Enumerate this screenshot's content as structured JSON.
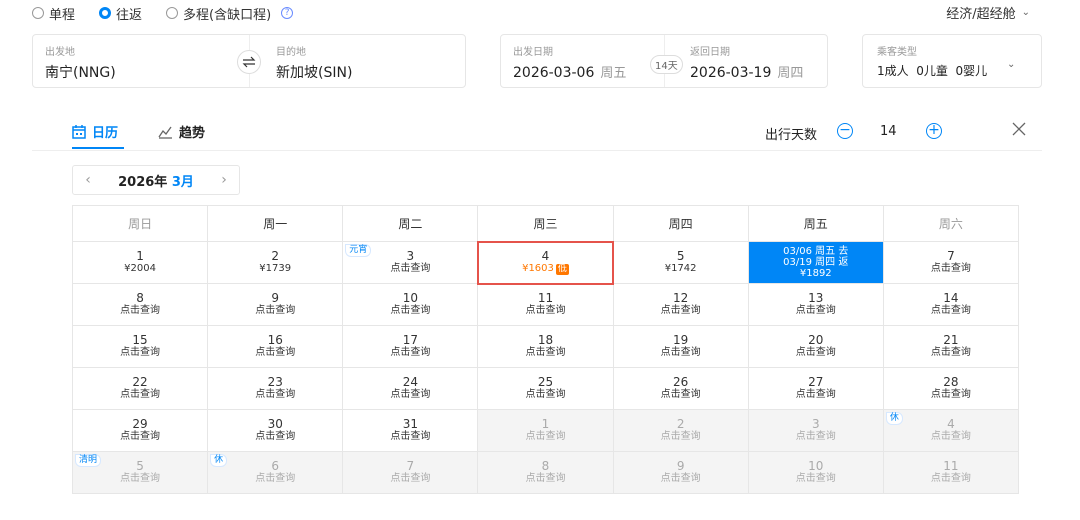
{
  "trip_types": [
    {
      "label": "单程",
      "checked": false
    },
    {
      "label": "往返",
      "checked": true
    },
    {
      "label": "多程(含缺口程)",
      "checked": false
    }
  ],
  "help_glyph": "?",
  "cabin": {
    "label": "经济/超经舱"
  },
  "origin": {
    "label": "出发地",
    "value": "南宁(NNG)"
  },
  "destination": {
    "label": "目的地",
    "value": "新加坡(SIN)"
  },
  "depart": {
    "label": "出发日期",
    "date": "2026-03-06",
    "weekday": "周五"
  },
  "days_pill": "14天",
  "return": {
    "label": "返回日期",
    "date": "2026-03-19",
    "weekday": "周四"
  },
  "passengers": {
    "label": "乘客类型",
    "value": "1成人  0儿童  0婴儿"
  },
  "tabs": {
    "calendar": "日历",
    "trend": "趋势"
  },
  "trip_days": {
    "label": "出行天数",
    "value": "14"
  },
  "month_nav": {
    "year": "2026年",
    "month": "3月"
  },
  "weekdays": [
    "周日",
    "周一",
    "周二",
    "周三",
    "周四",
    "周五",
    "周六"
  ],
  "calendar": [
    [
      {
        "d": "1",
        "p": "¥2004"
      },
      {
        "d": "2",
        "p": "¥1739"
      },
      {
        "d": "3",
        "p": "点击查询",
        "tag": "元宵"
      },
      {
        "d": "4",
        "p": "¥1603",
        "low": "低",
        "hl": true
      },
      {
        "d": "5",
        "p": "¥1742"
      },
      {
        "sel": true,
        "l1": "03/06 周五 去",
        "l2": "03/19 周四 返",
        "l3": "¥1892"
      },
      {
        "d": "7",
        "p": "点击查询"
      }
    ],
    [
      {
        "d": "8",
        "p": "点击查询"
      },
      {
        "d": "9",
        "p": "点击查询"
      },
      {
        "d": "10",
        "p": "点击查询"
      },
      {
        "d": "11",
        "p": "点击查询"
      },
      {
        "d": "12",
        "p": "点击查询"
      },
      {
        "d": "13",
        "p": "点击查询"
      },
      {
        "d": "14",
        "p": "点击查询"
      }
    ],
    [
      {
        "d": "15",
        "p": "点击查询"
      },
      {
        "d": "16",
        "p": "点击查询"
      },
      {
        "d": "17",
        "p": "点击查询"
      },
      {
        "d": "18",
        "p": "点击查询"
      },
      {
        "d": "19",
        "p": "点击查询"
      },
      {
        "d": "20",
        "p": "点击查询"
      },
      {
        "d": "21",
        "p": "点击查询"
      }
    ],
    [
      {
        "d": "22",
        "p": "点击查询"
      },
      {
        "d": "23",
        "p": "点击查询"
      },
      {
        "d": "24",
        "p": "点击查询"
      },
      {
        "d": "25",
        "p": "点击查询"
      },
      {
        "d": "26",
        "p": "点击查询"
      },
      {
        "d": "27",
        "p": "点击查询"
      },
      {
        "d": "28",
        "p": "点击查询"
      }
    ],
    [
      {
        "d": "29",
        "p": "点击查询"
      },
      {
        "d": "30",
        "p": "点击查询"
      },
      {
        "d": "31",
        "p": "点击查询"
      },
      {
        "d": "1",
        "p": "点击查询",
        "other": true
      },
      {
        "d": "2",
        "p": "点击查询",
        "other": true
      },
      {
        "d": "3",
        "p": "点击查询",
        "other": true
      },
      {
        "d": "4",
        "p": "点击查询",
        "other": true,
        "tag": "休"
      }
    ],
    [
      {
        "d": "5",
        "p": "点击查询",
        "other": true,
        "tag": "清明"
      },
      {
        "d": "6",
        "p": "点击查询",
        "other": true,
        "tag": "休"
      },
      {
        "d": "7",
        "p": "点击查询",
        "other": true
      },
      {
        "d": "8",
        "p": "点击查询",
        "other": true
      },
      {
        "d": "9",
        "p": "点击查询",
        "other": true
      },
      {
        "d": "10",
        "p": "点击查询",
        "other": true
      },
      {
        "d": "11",
        "p": "点击查询",
        "other": true
      }
    ]
  ],
  "colors": {
    "accent": "#0086f6",
    "low_price": "#ff7700",
    "highlight_border": "#e5534b"
  },
  "icons": [
    "calendar-icon",
    "trend-icon",
    "swap-icon",
    "minus-icon",
    "plus-icon",
    "close-icon",
    "chevron-down-icon",
    "chevron-left-icon",
    "chevron-right-icon",
    "help-icon"
  ]
}
